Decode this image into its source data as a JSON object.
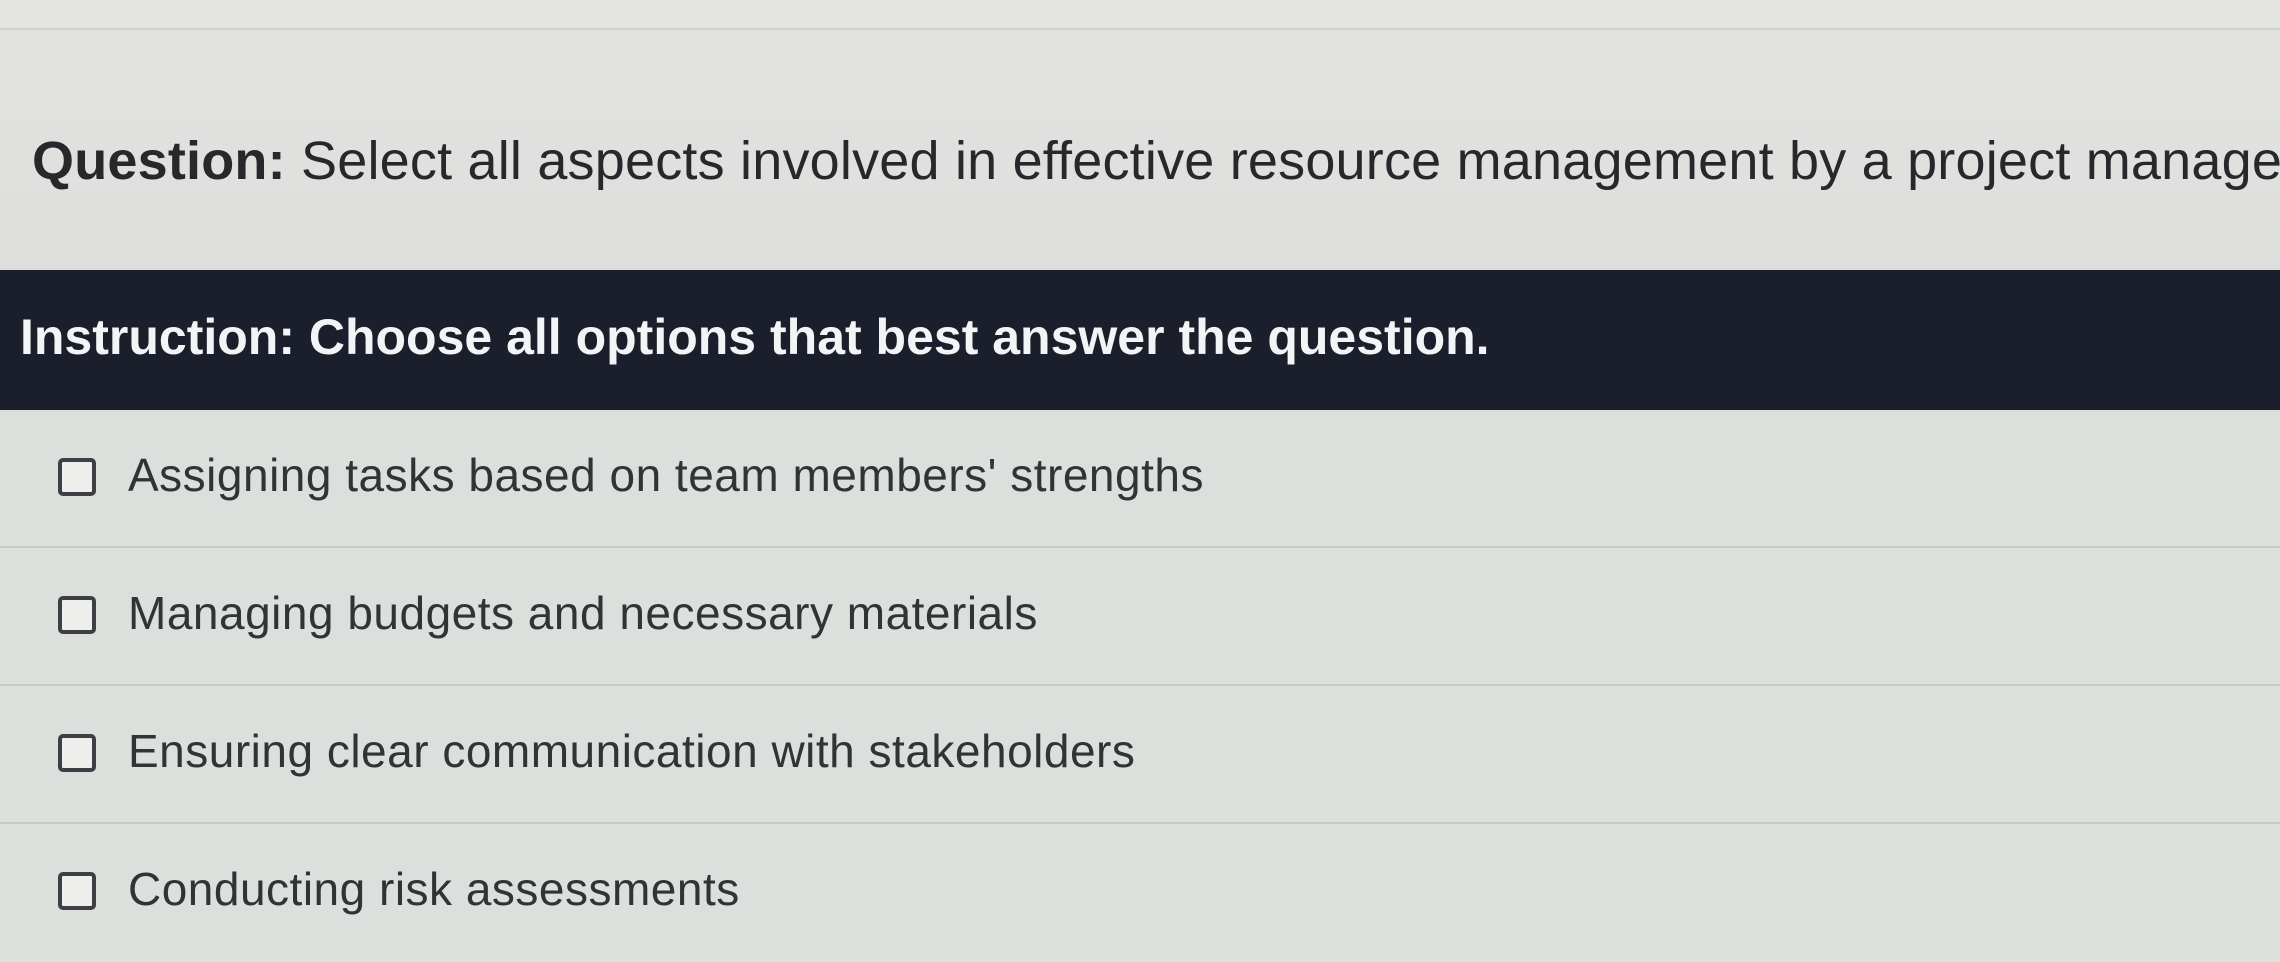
{
  "question": {
    "label": "Question:",
    "text": "Select all aspects involved in effective resource management by a project manager."
  },
  "instruction": {
    "text": "Instruction: Choose all options that best answer the question."
  },
  "options": [
    {
      "label": "Assigning tasks based on team members' strengths",
      "checked": false
    },
    {
      "label": "Managing budgets and necessary materials",
      "checked": false
    },
    {
      "label": "Ensuring clear communication with stakeholders",
      "checked": false
    },
    {
      "label": "Conducting risk assessments",
      "checked": false
    }
  ]
}
